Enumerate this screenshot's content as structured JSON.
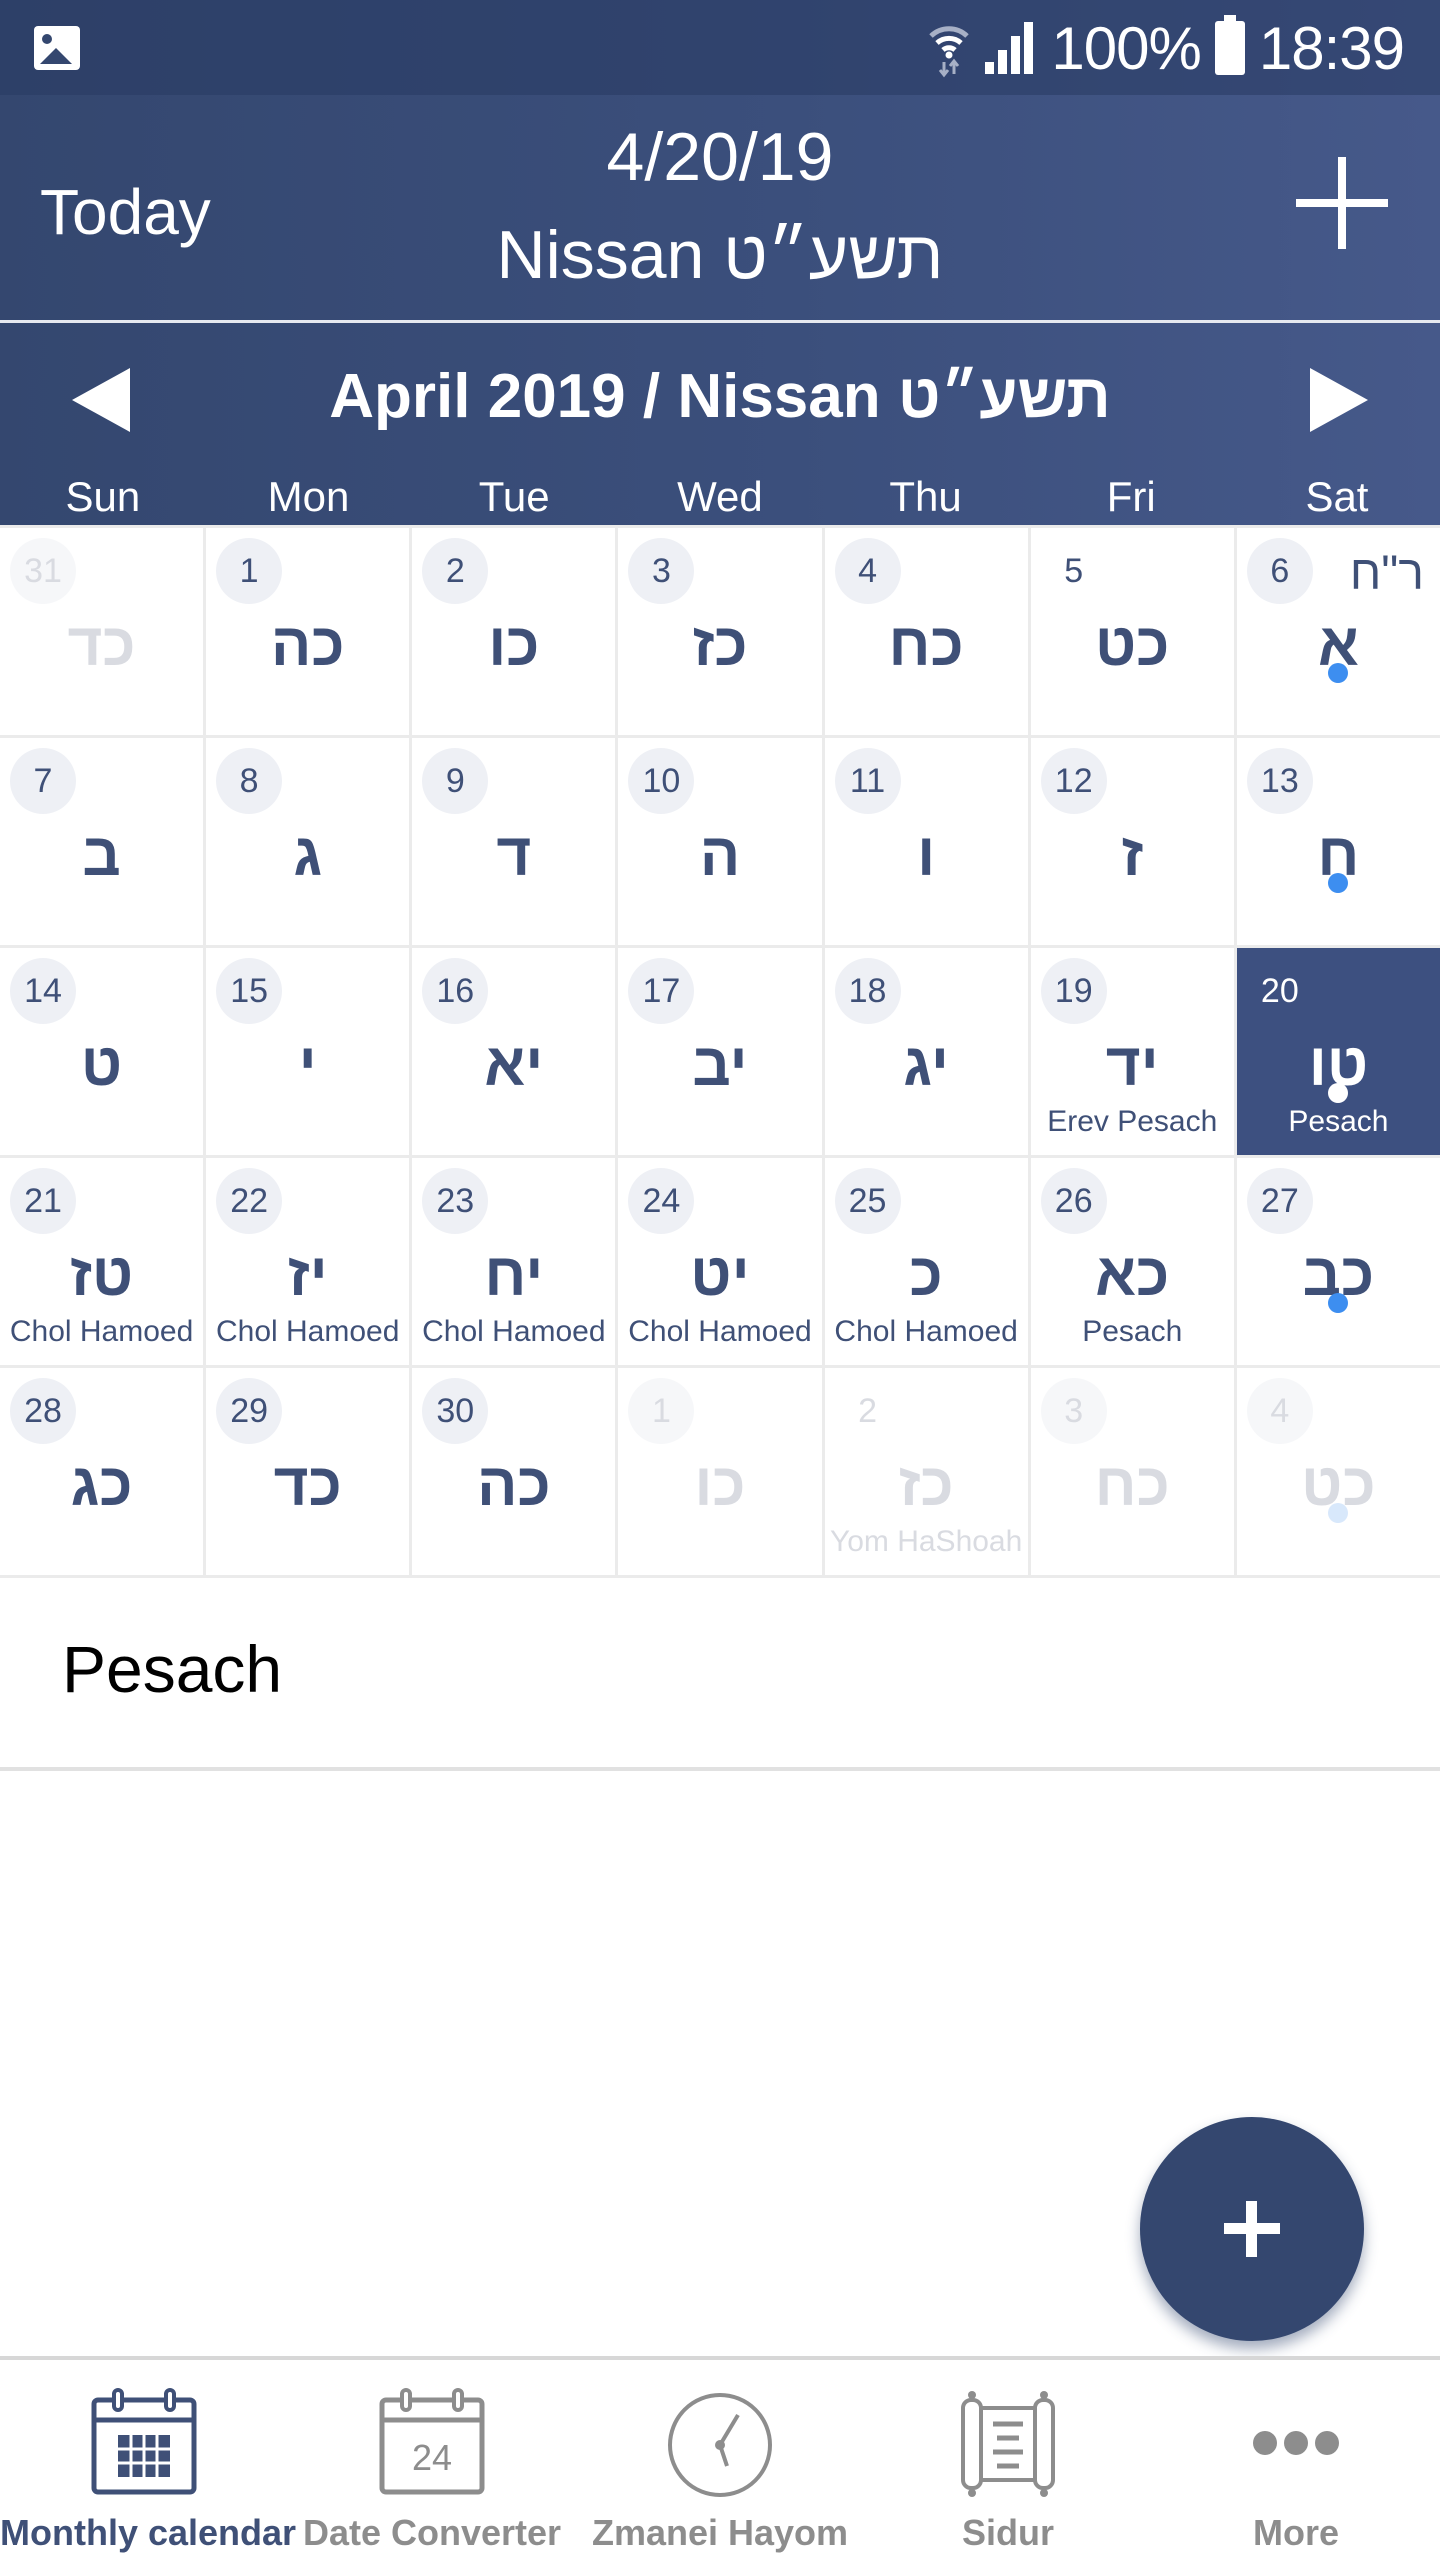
{
  "status_bar": {
    "left_icon": "gallery-icon",
    "icons": [
      "wifi-icon",
      "signal-icon",
      "battery-icon"
    ],
    "battery": "100%",
    "time": "18:39"
  },
  "header": {
    "today_label": "Today",
    "gregorian_date": "4/20/19",
    "hebrew_date": "Nissan תשע״ט",
    "add_icon": "plus-icon"
  },
  "month_nav": {
    "title": "April 2019 / Nissan תשע״ט",
    "prev_icon": "triangle-left-icon",
    "next_icon": "triangle-right-icon"
  },
  "weekdays": [
    "Sun",
    "Mon",
    "Tue",
    "Wed",
    "Thu",
    "Fri",
    "Sat"
  ],
  "calendar": {
    "selected_day": 20,
    "days": [
      {
        "num": "31",
        "heb": "כד",
        "other": true,
        "circle": true
      },
      {
        "num": "1",
        "heb": "כה",
        "circle": true
      },
      {
        "num": "2",
        "heb": "כו",
        "circle": true
      },
      {
        "num": "3",
        "heb": "כז",
        "circle": true
      },
      {
        "num": "4",
        "heb": "כח",
        "circle": true
      },
      {
        "num": "5",
        "heb": "כט",
        "circle": false
      },
      {
        "num": "6",
        "heb": "א",
        "circle": true,
        "dot": true,
        "corner": "ר\"ח"
      },
      {
        "num": "7",
        "heb": "ב",
        "circle": true
      },
      {
        "num": "8",
        "heb": "ג",
        "circle": true
      },
      {
        "num": "9",
        "heb": "ד",
        "circle": true
      },
      {
        "num": "10",
        "heb": "ה",
        "circle": true
      },
      {
        "num": "11",
        "heb": "ו",
        "circle": true
      },
      {
        "num": "12",
        "heb": "ז",
        "circle": true
      },
      {
        "num": "13",
        "heb": "ח",
        "circle": true,
        "dot": true
      },
      {
        "num": "14",
        "heb": "ט",
        "circle": true
      },
      {
        "num": "15",
        "heb": "י",
        "circle": true
      },
      {
        "num": "16",
        "heb": "יא",
        "circle": true
      },
      {
        "num": "17",
        "heb": "יב",
        "circle": true
      },
      {
        "num": "18",
        "heb": "יג",
        "circle": true
      },
      {
        "num": "19",
        "heb": "יד",
        "circle": true,
        "event": "Erev Pesach"
      },
      {
        "num": "20",
        "heb": "טו",
        "circle": false,
        "dot": true,
        "event": "Pesach",
        "selected": true
      },
      {
        "num": "21",
        "heb": "טז",
        "circle": true,
        "event": "Chol Hamoed"
      },
      {
        "num": "22",
        "heb": "יז",
        "circle": true,
        "event": "Chol Hamoed"
      },
      {
        "num": "23",
        "heb": "יח",
        "circle": true,
        "event": "Chol Hamoed"
      },
      {
        "num": "24",
        "heb": "יט",
        "circle": true,
        "event": "Chol Hamoed"
      },
      {
        "num": "25",
        "heb": "כ",
        "circle": true,
        "event": "Chol Hamoed"
      },
      {
        "num": "26",
        "heb": "כא",
        "circle": true,
        "event": "Pesach"
      },
      {
        "num": "27",
        "heb": "כב",
        "circle": true,
        "dot": true
      },
      {
        "num": "28",
        "heb": "כג",
        "circle": true
      },
      {
        "num": "29",
        "heb": "כד",
        "circle": true
      },
      {
        "num": "30",
        "heb": "כה",
        "circle": true
      },
      {
        "num": "1",
        "heb": "כו",
        "other": true,
        "circle": true
      },
      {
        "num": "2",
        "heb": "כז",
        "other": true,
        "circle": false,
        "event": "Yom HaShoah"
      },
      {
        "num": "3",
        "heb": "כח",
        "other": true,
        "circle": true
      },
      {
        "num": "4",
        "heb": "כט",
        "other": true,
        "circle": true,
        "dot": true
      }
    ]
  },
  "details": {
    "title": "Pesach"
  },
  "fab": {
    "icon": "plus-icon"
  },
  "bottom_nav": {
    "tabs": [
      {
        "label": "Monthly calendar",
        "icon": "calendar-grid-icon",
        "active": true
      },
      {
        "label": "Date Converter",
        "icon": "calendar-date-icon",
        "icon_text": "24"
      },
      {
        "label": "Zmanei Hayom",
        "icon": "clock-icon"
      },
      {
        "label": "Sidur",
        "icon": "scroll-icon"
      },
      {
        "label": "More",
        "icon": "more-dots-icon"
      }
    ]
  },
  "colors": {
    "primary": "#34476f",
    "selected_cell": "#3d5080",
    "event_dot": "#3d8ef0",
    "text_dark": "#3f5077",
    "inactive_tab": "#8d8d8d"
  }
}
